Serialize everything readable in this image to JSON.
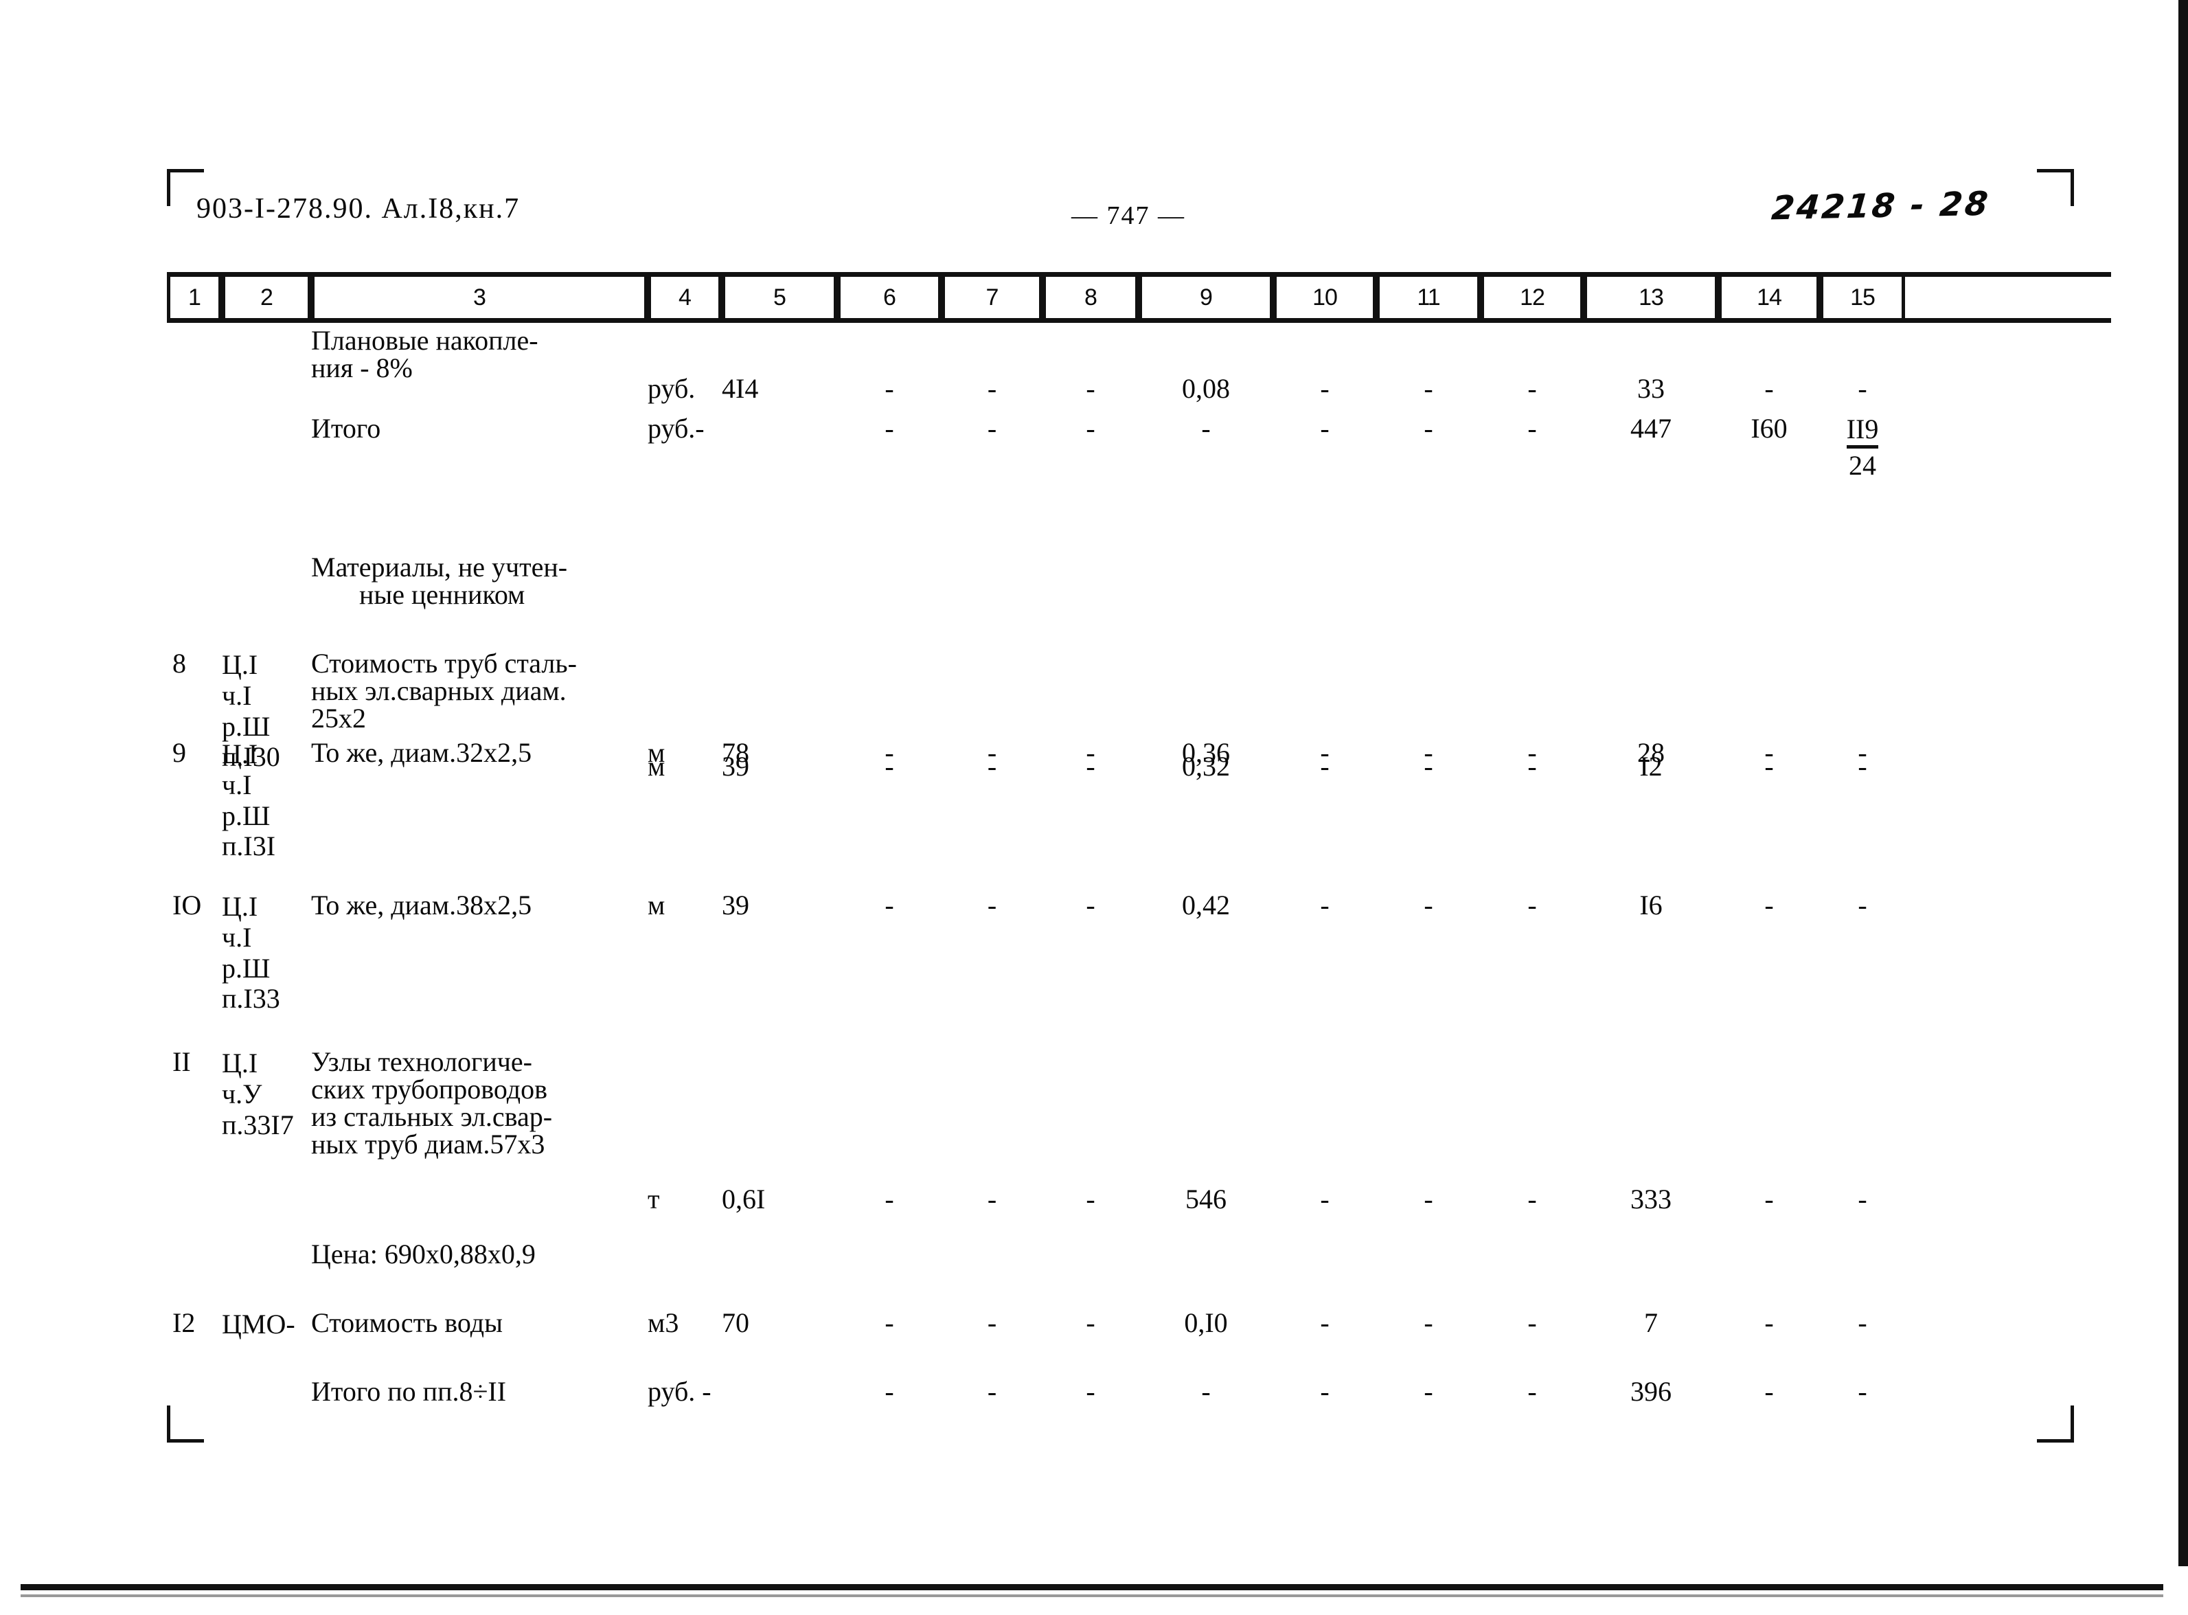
{
  "header": {
    "doc_code": "903-I-278.90.  Ал.I8,кн.7",
    "page_number": "— 747 —",
    "hand_code": "24218 - 28"
  },
  "table": {
    "column_headers": [
      "1",
      "2",
      "3",
      "4",
      "5",
      "6",
      "7",
      "8",
      "9",
      "10",
      "11",
      "12",
      "13",
      "14",
      "15"
    ],
    "rows": [
      {
        "n": "",
        "code": "",
        "desc": [
          "Плановые накопле-",
          "ния - 8%"
        ],
        "unit": "руб.",
        "c5": "4I4",
        "c6": "-",
        "c7": "-",
        "c8": "-",
        "c9": "0,08",
        "c10": "-",
        "c11": "-",
        "c12": "-",
        "c13": "33",
        "c14": "-",
        "c15": "-"
      },
      {
        "n": "",
        "code": "",
        "desc": [
          "Итого"
        ],
        "unit": "руб.-",
        "c5": "",
        "c6": "-",
        "c7": "-",
        "c8": "-",
        "c9": "-",
        "c10": "-",
        "c11": "-",
        "c12": "-",
        "c13": "447",
        "c14": "I60",
        "c15_num": "II9",
        "c15_den": "24"
      },
      {
        "n": "",
        "code": "",
        "desc": [
          "Материалы, не учтен-",
          "ные ценником"
        ],
        "unit": "",
        "c5": "",
        "c6": "",
        "c7": "",
        "c8": "",
        "c9": "",
        "c10": "",
        "c11": "",
        "c12": "",
        "c13": "",
        "c14": "",
        "c15": ""
      },
      {
        "n": "8",
        "code": [
          "Ц.I",
          "ч.I",
          "р.Ш",
          "п.I30"
        ],
        "desc": [
          "Стоимость труб сталь-",
          "ных эл.сварных диам.",
          "25х2"
        ],
        "unit": "м",
        "c5": "39",
        "c6": "-",
        "c7": "-",
        "c8": "-",
        "c9": "0,32",
        "c10": "-",
        "c11": "-",
        "c12": "-",
        "c13": "I2",
        "c14": "-",
        "c15": "-"
      },
      {
        "n": "9",
        "code": [
          "Ц.I",
          "ч.I",
          "р.Ш",
          "п.I3I"
        ],
        "desc": [
          "То же, диам.32х2,5"
        ],
        "unit": "м",
        "c5": "78",
        "c6": "-",
        "c7": "-",
        "c8": "-",
        "c9": "0,36",
        "c10": "-",
        "c11": "-",
        "c12": "-",
        "c13": "28",
        "c14": "-",
        "c15": "-"
      },
      {
        "n": "IO",
        "code": [
          "Ц.I",
          "ч.I",
          "р.Ш",
          "п.I33"
        ],
        "desc": [
          "То же, диам.38х2,5"
        ],
        "unit": "м",
        "c5": "39",
        "c6": "-",
        "c7": "-",
        "c8": "-",
        "c9": "0,42",
        "c10": "-",
        "c11": "-",
        "c12": "-",
        "c13": "I6",
        "c14": "-",
        "c15": "-"
      },
      {
        "n": "II",
        "code": [
          "Ц.I",
          "ч.У",
          "п.33I7"
        ],
        "desc": [
          "Узлы технологиче-",
          "ских трубопроводов",
          "из стальных эл.свар-",
          "ных труб диам.57х3"
        ],
        "unit": "т",
        "c5": "0,6I",
        "c6": "-",
        "c7": "-",
        "c8": "-",
        "c9": "546",
        "c10": "-",
        "c11": "-",
        "c12": "-",
        "c13": "333",
        "c14": "-",
        "c15": "-"
      },
      {
        "n": "",
        "code": "",
        "desc": [
          "Цена: 690х0,88х0,9"
        ],
        "unit": "",
        "c5": "",
        "c6": "",
        "c7": "",
        "c8": "",
        "c9": "",
        "c10": "",
        "c11": "",
        "c12": "",
        "c13": "",
        "c14": "",
        "c15": ""
      },
      {
        "n": "I2",
        "code": [
          "ЦМО-"
        ],
        "desc": [
          "Стоимость воды"
        ],
        "unit": "м3",
        "c5": "70",
        "c6": "-",
        "c7": "-",
        "c8": "-",
        "c9": "0,I0",
        "c10": "-",
        "c11": "-",
        "c12": "-",
        "c13": "7",
        "c14": "-",
        "c15": "-"
      },
      {
        "n": "",
        "code": "",
        "desc": [
          "Итого по пп.8÷II"
        ],
        "unit": "руб. -",
        "c5": "",
        "c6": "-",
        "c7": "-",
        "c8": "-",
        "c9": "-",
        "c10": "-",
        "c11": "-",
        "c12": "-",
        "c13": "396",
        "c14": "-",
        "c15": "-"
      }
    ]
  }
}
